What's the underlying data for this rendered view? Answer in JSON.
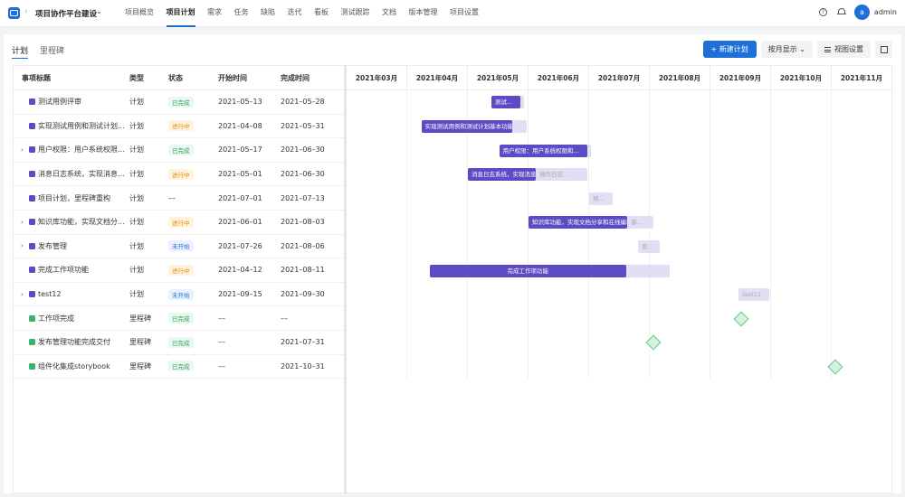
{
  "header": {
    "project_name": "项目协作平台建设",
    "nav": [
      "项目概览",
      "项目计划",
      "需求",
      "任务",
      "缺陷",
      "迭代",
      "看板",
      "测试跟踪",
      "文档",
      "版本管理",
      "项目设置"
    ],
    "active_nav": "项目计划",
    "avatar_letter": "a",
    "user_name": "admin"
  },
  "subtabs": [
    "计划",
    "里程碑"
  ],
  "toolbar": {
    "new_plan": "+ 新建计划",
    "view_by": "按月显示 ⌄",
    "view_settings": "视图设置"
  },
  "table": {
    "headers": [
      "事项标题",
      "类型",
      "状态",
      "开始时间",
      "完成时间"
    ],
    "rows": [
      {
        "title": "测试用例评审",
        "type": "计划",
        "status": "已完成",
        "status_kind": "done",
        "start": "2021–05–13",
        "end": "2021–05–28",
        "expand": "",
        "icon": "plan"
      },
      {
        "title": "实现测试用例和测试计划...",
        "type": "计划",
        "status": "进行中",
        "status_kind": "doing",
        "start": "2021–04–08",
        "end": "2021–05–31",
        "expand": "",
        "icon": "plan"
      },
      {
        "title": "用户权限：用户系统权限...",
        "type": "计划",
        "status": "已完成",
        "status_kind": "done",
        "start": "2021–05–17",
        "end": "2021–06–30",
        "expand": "›",
        "icon": "plan"
      },
      {
        "title": "消息日志系统，实现消息...",
        "type": "计划",
        "status": "进行中",
        "status_kind": "doing",
        "start": "2021–05–01",
        "end": "2021–06–30",
        "expand": "",
        "icon": "plan"
      },
      {
        "title": "项目计划，里程碑重构",
        "type": "计划",
        "status": "––",
        "status_kind": "none",
        "start": "2021–07–01",
        "end": "2021–07–13",
        "expand": "",
        "icon": "plan"
      },
      {
        "title": "知识库功能，实现文档分...",
        "type": "计划",
        "status": "进行中",
        "status_kind": "doing",
        "start": "2021–06–01",
        "end": "2021–08–03",
        "expand": "›",
        "icon": "plan"
      },
      {
        "title": "发布管理",
        "type": "计划",
        "status": "未开始",
        "status_kind": "todo",
        "start": "2021–07–26",
        "end": "2021–08–06",
        "expand": "›",
        "icon": "plan"
      },
      {
        "title": "完成工作项功能",
        "type": "计划",
        "status": "进行中",
        "status_kind": "doing",
        "start": "2021–04–12",
        "end": "2021–08–11",
        "expand": "",
        "icon": "plan"
      },
      {
        "title": "test12",
        "type": "计划",
        "status": "未开始",
        "status_kind": "todo",
        "start": "2021–09–15",
        "end": "2021–09–30",
        "expand": "›",
        "icon": "plan"
      },
      {
        "title": "工作项完成",
        "type": "里程碑",
        "status": "已完成",
        "status_kind": "done",
        "start": "––",
        "end": "––",
        "expand": "",
        "icon": "ms"
      },
      {
        "title": "发布管理功能完成交付",
        "type": "里程碑",
        "status": "已完成",
        "status_kind": "done",
        "start": "––",
        "end": "2021–07–31",
        "expand": "",
        "icon": "ms"
      },
      {
        "title": "组件化集成storybook",
        "type": "里程碑",
        "status": "已完成",
        "status_kind": "done",
        "start": "––",
        "end": "2021–10–31",
        "expand": "",
        "icon": "ms"
      }
    ]
  },
  "gantt": {
    "months": [
      "2021年03月",
      "2021年04月",
      "2021年05月",
      "2021年06月",
      "2021年07月",
      "2021年08月",
      "2021年09月",
      "2021年10月",
      "2021年11月"
    ],
    "bars": [
      {
        "label": "测试...",
        "rest_label": ""
      },
      {
        "label": "实现测试用例和测试计划基本功能",
        "rest_label": ""
      },
      {
        "label": "用户权限：用户系统权限和...",
        "rest_label": ""
      },
      {
        "label": "消息日志系统，实现消息提醒，",
        "rest_label": "操作日志..."
      },
      {
        "label": "",
        "rest_label": "项..."
      },
      {
        "label": "知识库功能，实现文档分享和在线编辑，",
        "rest_label": "基..."
      },
      {
        "label": "",
        "rest_label": "发..."
      },
      {
        "label": "完成工作项功能",
        "rest_label": ""
      },
      {
        "label": "",
        "rest_label": "test12"
      }
    ]
  },
  "colors": {
    "accent": "#1f6fd8",
    "plan_bar": "#5b4bc4",
    "bar_rest": "#e0dff3",
    "milestone": "#65c58a"
  }
}
